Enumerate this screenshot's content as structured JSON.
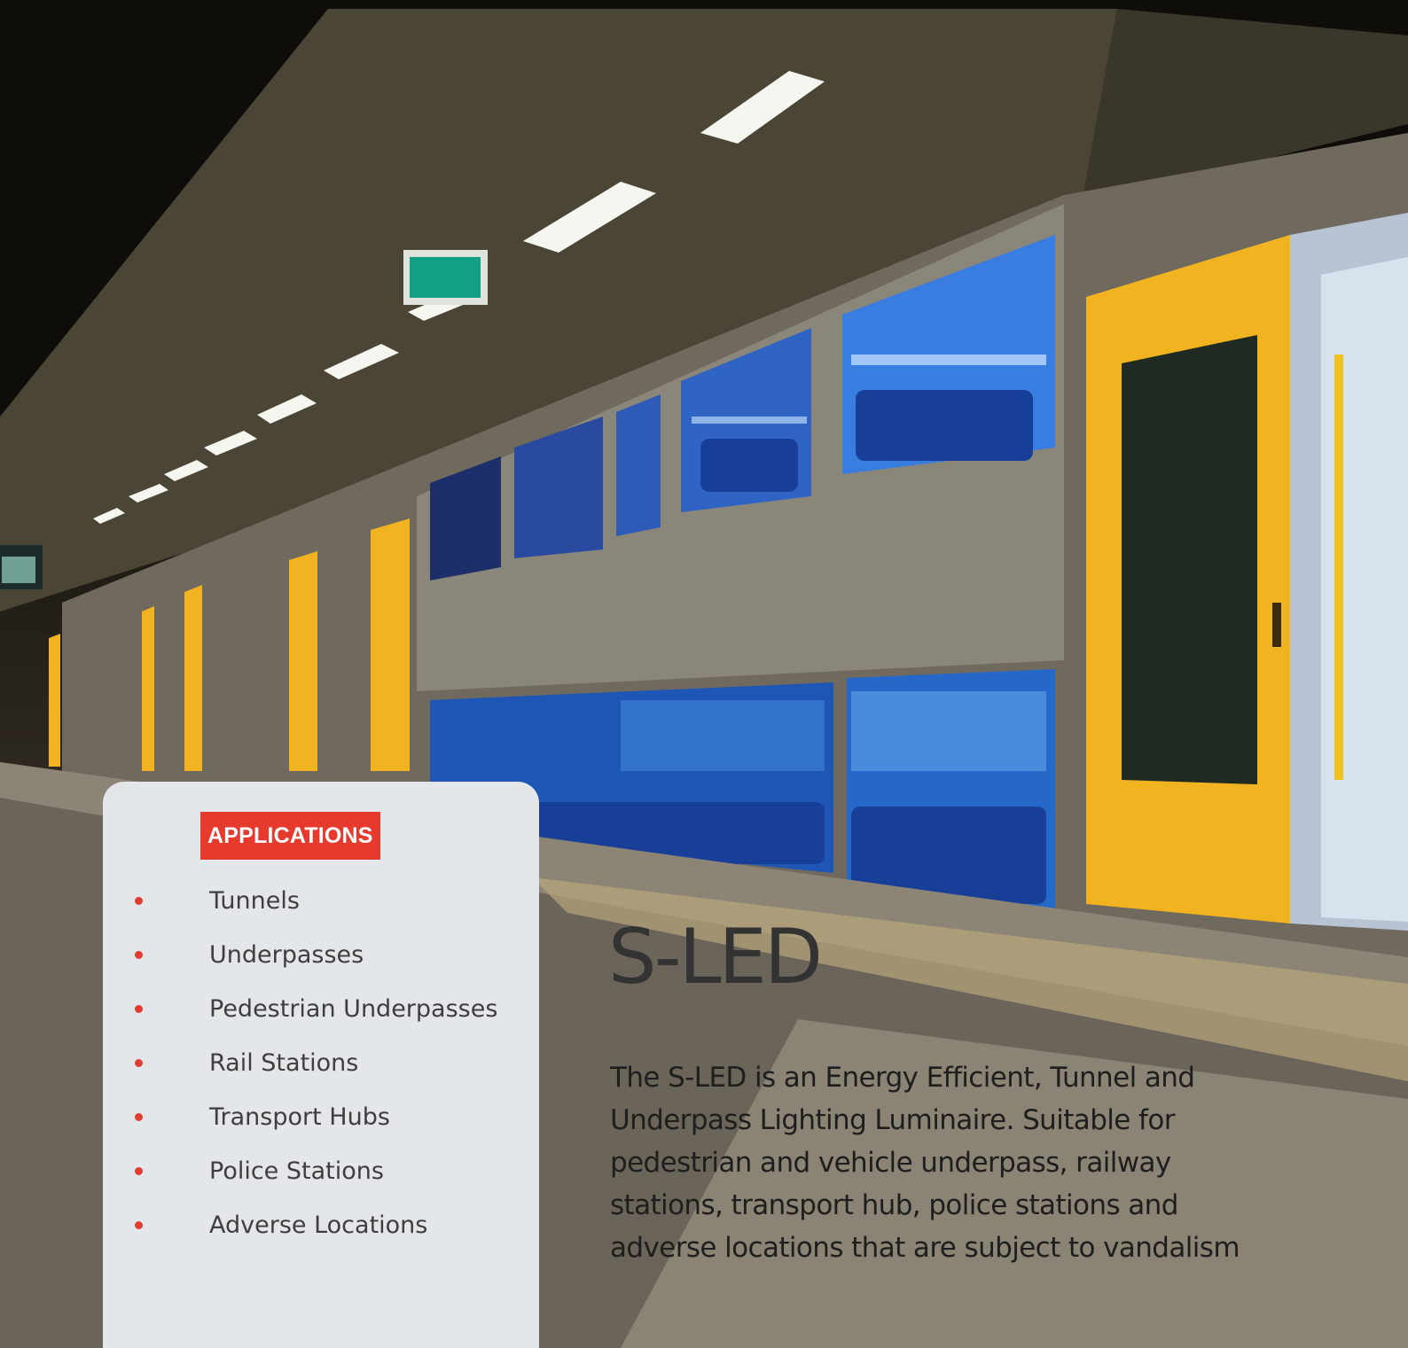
{
  "applications": {
    "heading": "APPLICATIONS",
    "items": [
      "Tunnels",
      "Underpasses",
      "Pedestrian Underpasses",
      "Rail Stations",
      "Transport Hubs",
      "Police Stations",
      "Adverse Locations"
    ]
  },
  "product": {
    "title": "S-LED",
    "description": "The S-LED is an Energy Efficient, Tunnel and Underpass Lighting Luminaire. Suitable for pedestrian and vehicle underpass, railway stations, transport hub, police stations and adverse locations that are subject to vandalism"
  },
  "colors": {
    "accent": "#e63a2e",
    "panel": "#e4e7e9",
    "train_yellow": "#f2b320",
    "seat_blue": "#1f4fa8"
  }
}
